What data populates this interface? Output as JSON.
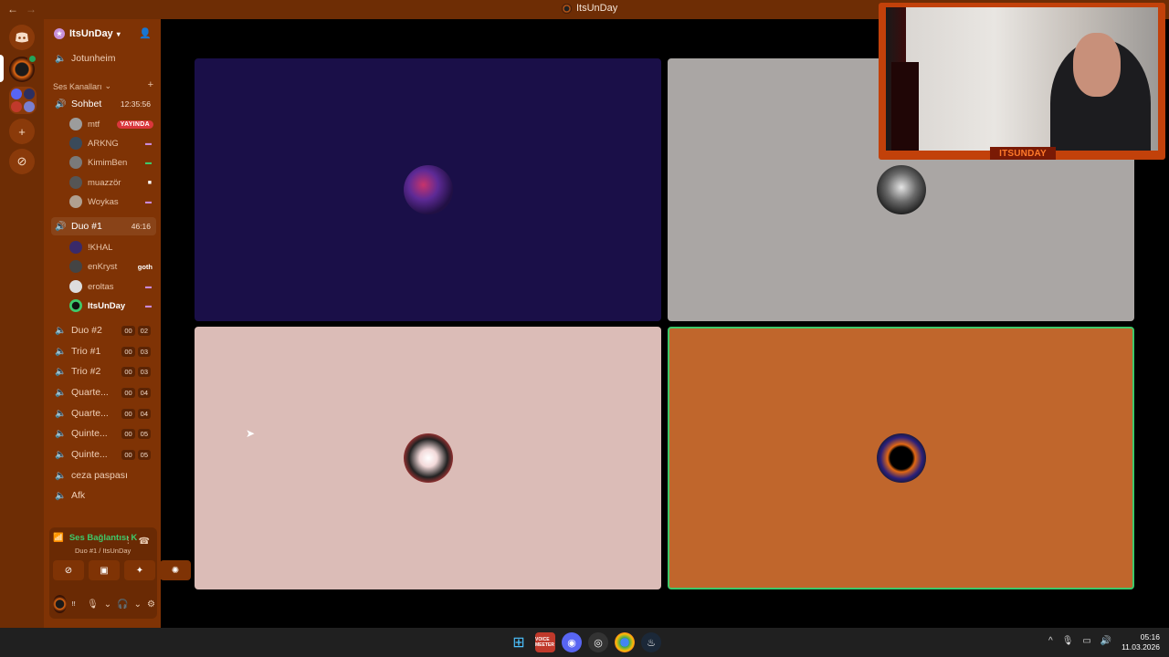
{
  "window": {
    "title": "ItsUnDay",
    "back": "←",
    "forward": "→"
  },
  "rail": {
    "home_icon": "discord-icon",
    "add_label": "+",
    "explore_label": "⊘"
  },
  "server": {
    "name": "ItsUnDay"
  },
  "channels": {
    "text_channel": "Jotunheim",
    "category": "Ses Kanalları",
    "voice": [
      {
        "name": "Sohbet",
        "time": "12:35:56"
      },
      {
        "name": "Duo #1",
        "time": "46:16"
      },
      {
        "name": "Duo #2",
        "a": "00",
        "b": "02"
      },
      {
        "name": "Trio #1",
        "a": "00",
        "b": "03"
      },
      {
        "name": "Trio #2",
        "a": "00",
        "b": "03"
      },
      {
        "name": "Quarte...",
        "a": "00",
        "b": "04"
      },
      {
        "name": "Quarte...",
        "a": "00",
        "b": "04"
      },
      {
        "name": "Quinte...",
        "a": "00",
        "b": "05"
      },
      {
        "name": "Quinte...",
        "a": "00",
        "b": "05"
      },
      {
        "name": "ceza paspası"
      },
      {
        "name": "Afk"
      }
    ]
  },
  "sohbet_users": [
    {
      "name": "mtf",
      "badge": "YAYINDA"
    },
    {
      "name": "ARKNG"
    },
    {
      "name": "KimimBen"
    },
    {
      "name": "muazzör"
    },
    {
      "name": "Woykas"
    }
  ],
  "duo_users": [
    {
      "name": "!KHAL"
    },
    {
      "name": "enKryst",
      "tag": "goth"
    },
    {
      "name": "eroltas"
    },
    {
      "name": "ItsUnDay"
    }
  ],
  "voice_panel": {
    "status": "Ses Bağlantısı K",
    "location": "Duo #1 / ItsUnDay",
    "user_initial": "!!"
  },
  "webcam": {
    "label": "ITSUNDAY"
  },
  "taskbar": {
    "vm_label": "VOICE MEETER",
    "time": "05:16",
    "date": "11.03.2026"
  },
  "colors": {
    "accent": "#7f3305",
    "speaking": "#3ec96a",
    "live": "#da373c"
  }
}
